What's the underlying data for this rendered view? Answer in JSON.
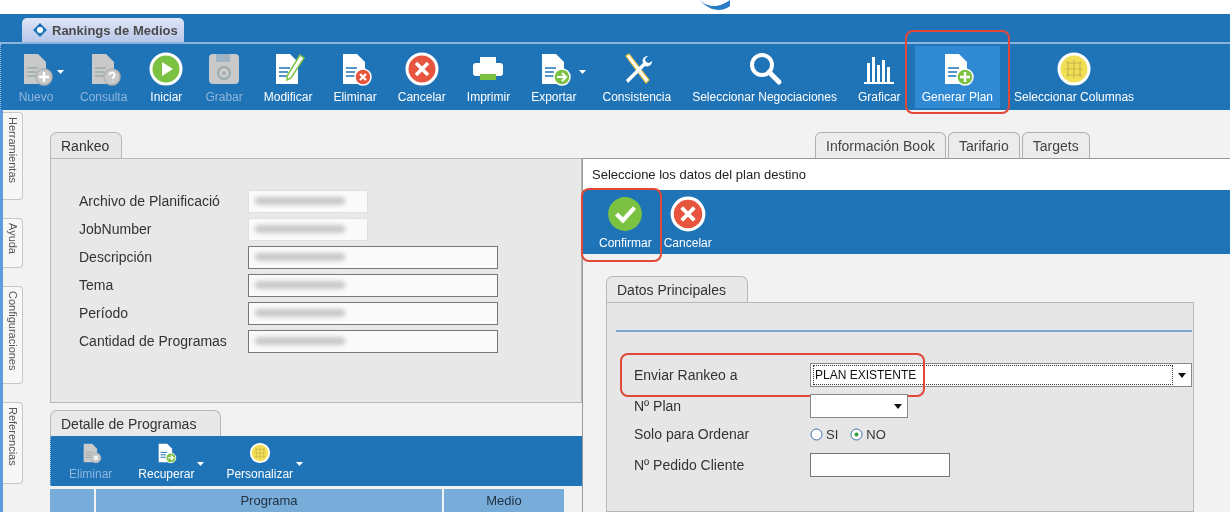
{
  "app_tab": {
    "title": "Rankings de Medios"
  },
  "toolbar": [
    {
      "label": "Nuevo",
      "kind": "doc-plus",
      "disabled": true,
      "dropdown": true,
      "selected": false,
      "highlighted": false
    },
    {
      "label": "Consulta",
      "kind": "doc-question",
      "disabled": true,
      "dropdown": false,
      "selected": false,
      "highlighted": false
    },
    {
      "label": "Iniciar",
      "kind": "play",
      "disabled": false,
      "dropdown": false,
      "selected": false,
      "highlighted": false
    },
    {
      "label": "Grabar",
      "kind": "disk",
      "disabled": true,
      "dropdown": false,
      "selected": false,
      "highlighted": false
    },
    {
      "label": "Modificar",
      "kind": "doc-pencil",
      "disabled": false,
      "dropdown": false,
      "selected": false,
      "highlighted": false
    },
    {
      "label": "Eliminar",
      "kind": "doc-x",
      "disabled": false,
      "dropdown": false,
      "selected": false,
      "highlighted": false
    },
    {
      "label": "Cancelar",
      "kind": "x-circle",
      "disabled": false,
      "dropdown": false,
      "selected": false,
      "highlighted": false
    },
    {
      "label": "Imprimir",
      "kind": "printer",
      "disabled": false,
      "dropdown": false,
      "selected": false,
      "highlighted": false
    },
    {
      "label": "Exportar",
      "kind": "doc-arrow",
      "disabled": false,
      "dropdown": true,
      "selected": false,
      "highlighted": false
    },
    {
      "label": "Consistencia",
      "kind": "tools",
      "disabled": false,
      "dropdown": false,
      "selected": false,
      "highlighted": false
    },
    {
      "label": "Seleccionar Negociaciones",
      "kind": "magnifier",
      "disabled": false,
      "dropdown": false,
      "selected": false,
      "highlighted": false
    },
    {
      "label": "Graficar",
      "kind": "bars",
      "disabled": false,
      "dropdown": false,
      "selected": false,
      "highlighted": false
    },
    {
      "label": "Generar Plan",
      "kind": "doc-plus",
      "disabled": false,
      "dropdown": false,
      "selected": true,
      "highlighted": true
    },
    {
      "label": "Seleccionar Columnas",
      "kind": "grid-circle",
      "disabled": false,
      "dropdown": false,
      "selected": false,
      "highlighted": false
    }
  ],
  "side_tabs": [
    "Herramientas",
    "Ayuda",
    "Configuraciones",
    "Referencias"
  ],
  "rankeo": {
    "tab": "Rankeo",
    "fields": [
      {
        "label": "Archivo de Planificació",
        "kind": "short"
      },
      {
        "label": "JobNumber",
        "kind": "short"
      },
      {
        "label": "Descripción",
        "kind": "long"
      },
      {
        "label": "Tema",
        "kind": "long"
      },
      {
        "label": "Período",
        "kind": "long"
      },
      {
        "label": "Cantidad de Programas",
        "kind": "long"
      }
    ]
  },
  "detalle": {
    "tab": "Detalle de Programas",
    "toolbar": [
      {
        "label": "Eliminar",
        "kind": "doc-x",
        "disabled": true,
        "dropdown": false
      },
      {
        "label": "Recuperar",
        "kind": "doc-arrow",
        "disabled": false,
        "dropdown": true
      },
      {
        "label": "Personalizar",
        "kind": "grid-circle",
        "disabled": false,
        "dropdown": true
      }
    ],
    "columns": [
      {
        "label": "Programa"
      },
      {
        "label": "Medio"
      }
    ]
  },
  "right_tabs": [
    {
      "label": "Información Book"
    },
    {
      "label": "Tarifario"
    },
    {
      "label": "Targets"
    }
  ],
  "dialog": {
    "title": "Seleccione los datos del plan destino",
    "toolbar": [
      {
        "label": "Confirmar",
        "kind": "check",
        "highlighted": true
      },
      {
        "label": "Cancelar",
        "kind": "x-circle",
        "highlighted": false
      }
    ],
    "tab": "Datos Principales",
    "form": [
      {
        "kind": "wide-select",
        "label": "Enviar Rankeo a",
        "value": "PLAN EXISTENTE",
        "highlighted": true
      },
      {
        "kind": "select",
        "label": "Nº Plan",
        "highlighted": false
      },
      {
        "kind": "radio",
        "label": "Solo para Ordenar",
        "options": [
          {
            "label": "SI",
            "selected": false
          },
          {
            "label": "NO",
            "selected": true
          }
        ]
      },
      {
        "kind": "text",
        "label": "Nº Pedido Cliente"
      }
    ]
  }
}
